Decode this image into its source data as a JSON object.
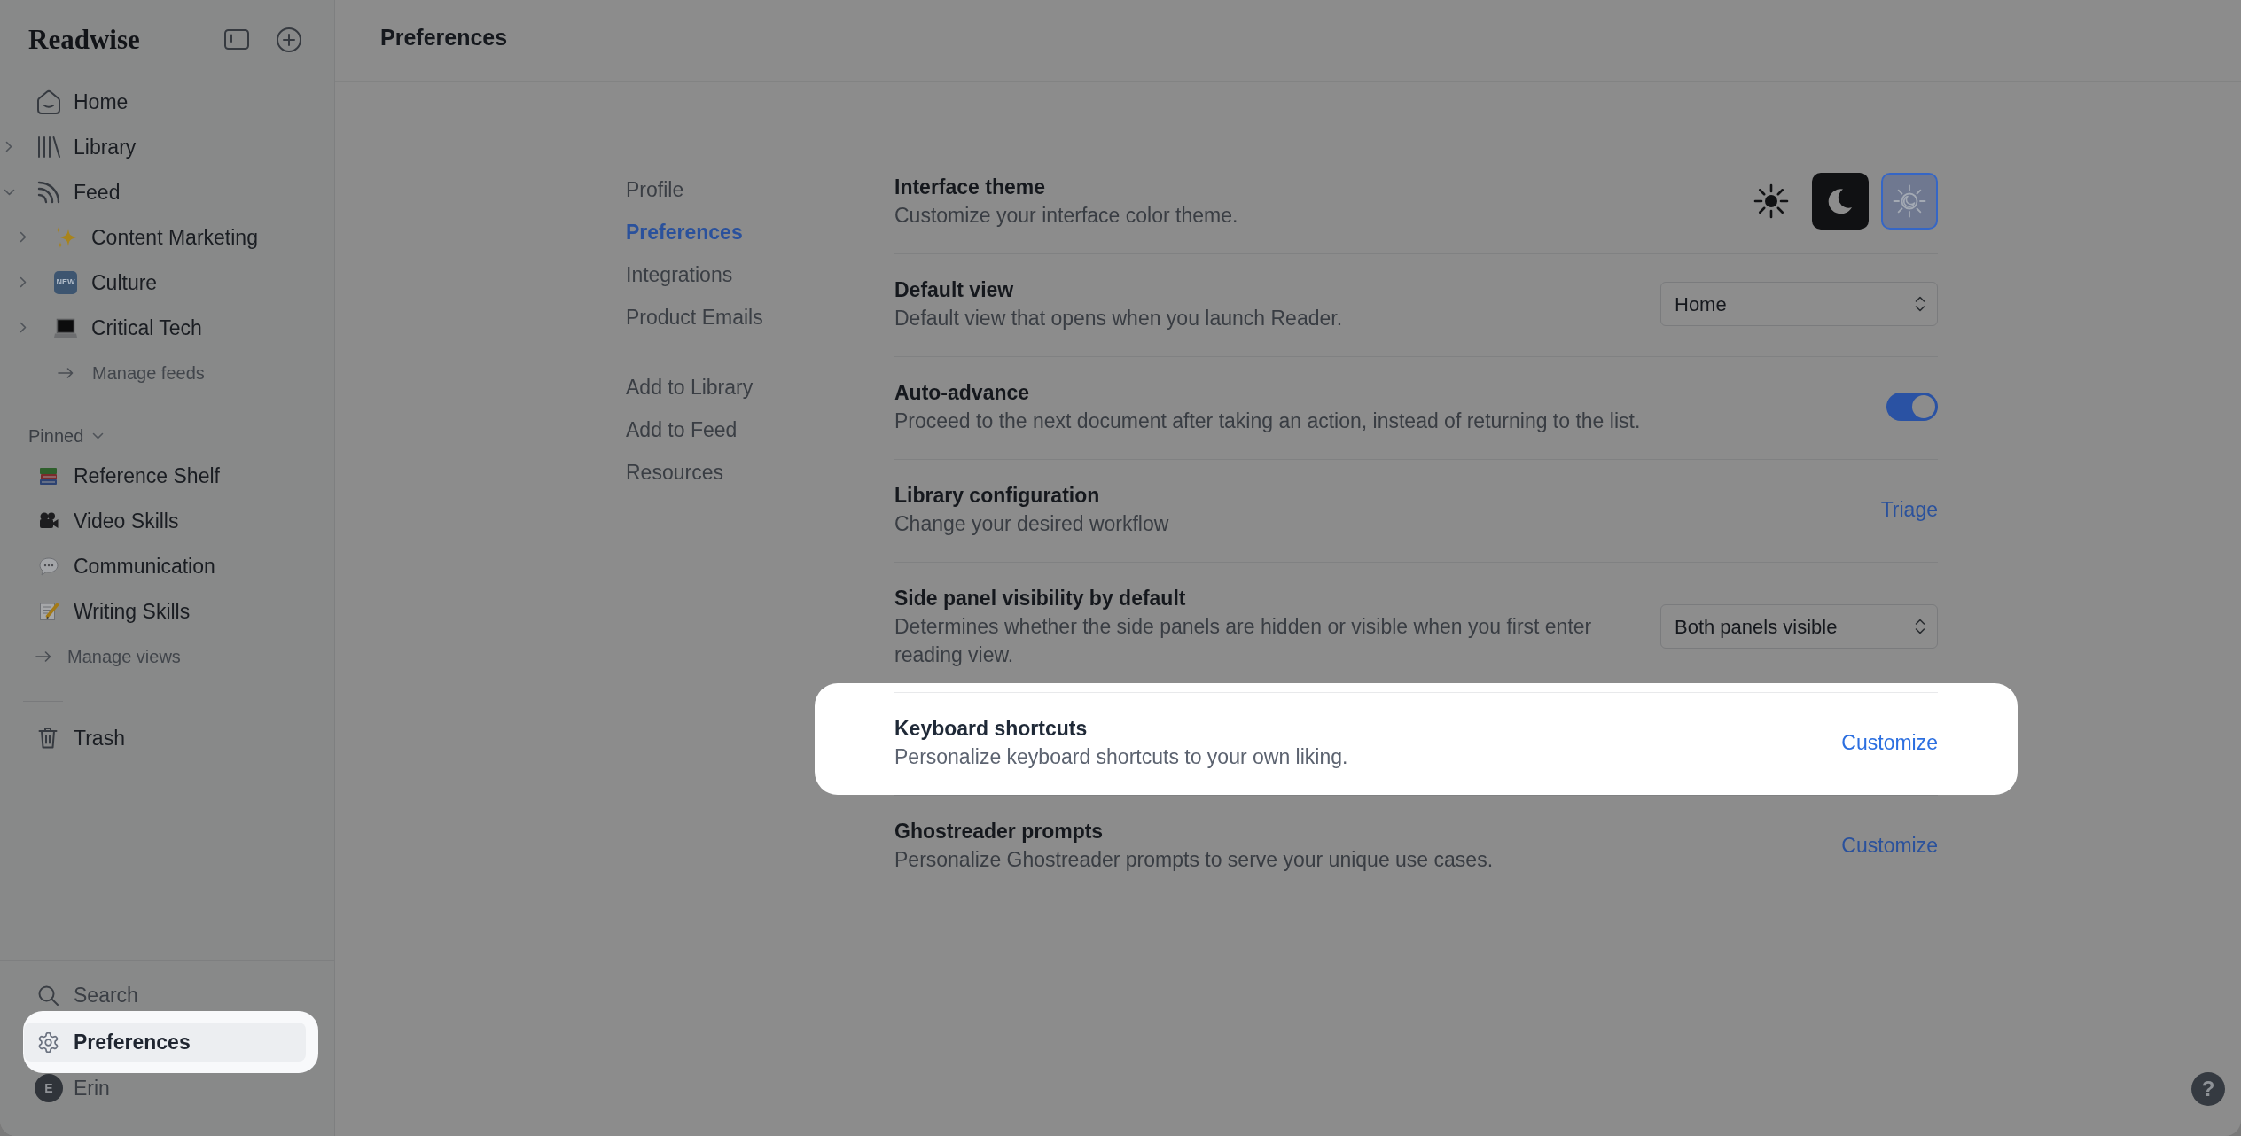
{
  "sidebar": {
    "logo": "Readwise",
    "nav": [
      {
        "label": "Home"
      },
      {
        "label": "Library",
        "expanded": false
      },
      {
        "label": "Feed",
        "expanded": true,
        "children": [
          {
            "label": "Content Marketing",
            "expanded": false
          },
          {
            "label": "Culture",
            "expanded": false,
            "badge": "NEW"
          },
          {
            "label": "Critical Tech",
            "expanded": false
          }
        ],
        "manage_link": "Manage feeds"
      }
    ],
    "pinned": {
      "label": "Pinned",
      "expanded": true,
      "items": [
        {
          "label": "Reference Shelf"
        },
        {
          "label": "Video Skills"
        },
        {
          "label": "Communication"
        },
        {
          "label": "Writing Skills"
        }
      ],
      "manage_link": "Manage views"
    },
    "trash": "Trash",
    "bottom_items": [
      {
        "label": "Search",
        "selected": false,
        "highlighted": false
      },
      {
        "label": "Preferences",
        "selected": true,
        "highlighted": true
      }
    ],
    "user": {
      "initial": "E",
      "name": "Erin"
    }
  },
  "header": {
    "title": "Preferences"
  },
  "settings_nav": {
    "sections": [
      {
        "items": [
          {
            "label": "Profile",
            "selected": false
          },
          {
            "label": "Preferences",
            "selected": true
          },
          {
            "label": "Integrations",
            "selected": false
          },
          {
            "label": "Product Emails",
            "selected": false
          }
        ]
      },
      {
        "items": [
          {
            "label": "Add to Library",
            "selected": false
          },
          {
            "label": "Add to Feed",
            "selected": false
          },
          {
            "label": "Resources",
            "selected": false
          }
        ]
      }
    ]
  },
  "settings": [
    {
      "kind": "theme",
      "title": "Interface theme",
      "description": "Customize your interface color theme.",
      "options": [
        {
          "selected": false
        },
        {
          "selected": false
        },
        {
          "selected": true
        }
      ],
      "highlighted": false
    },
    {
      "kind": "select",
      "title": "Default view",
      "description": "Default view that opens when you launch Reader.",
      "value": "Home",
      "highlighted": false
    },
    {
      "kind": "toggle",
      "title": "Auto-advance",
      "description": "Proceed to the next document after taking an action, instead of returning to the list.",
      "on": true,
      "highlighted": false
    },
    {
      "kind": "link",
      "title": "Library configuration",
      "description": "Change your desired workflow",
      "action": "Triage",
      "highlighted": false
    },
    {
      "kind": "select",
      "title": "Side panel visibility by default",
      "description": "Determines whether the side panels are hidden or visible when you first enter reading view.",
      "value": "Both panels visible",
      "highlighted": false
    },
    {
      "kind": "link",
      "title": "Keyboard shortcuts",
      "description": "Personalize keyboard shortcuts to your own liking.",
      "action": "Customize",
      "highlighted": true
    },
    {
      "kind": "link",
      "title": "Ghostreader prompts",
      "description": "Personalize Ghostreader prompts to serve your unique use cases.",
      "action": "Customize",
      "highlighted": false
    }
  ],
  "help_button": {
    "label": "?"
  }
}
